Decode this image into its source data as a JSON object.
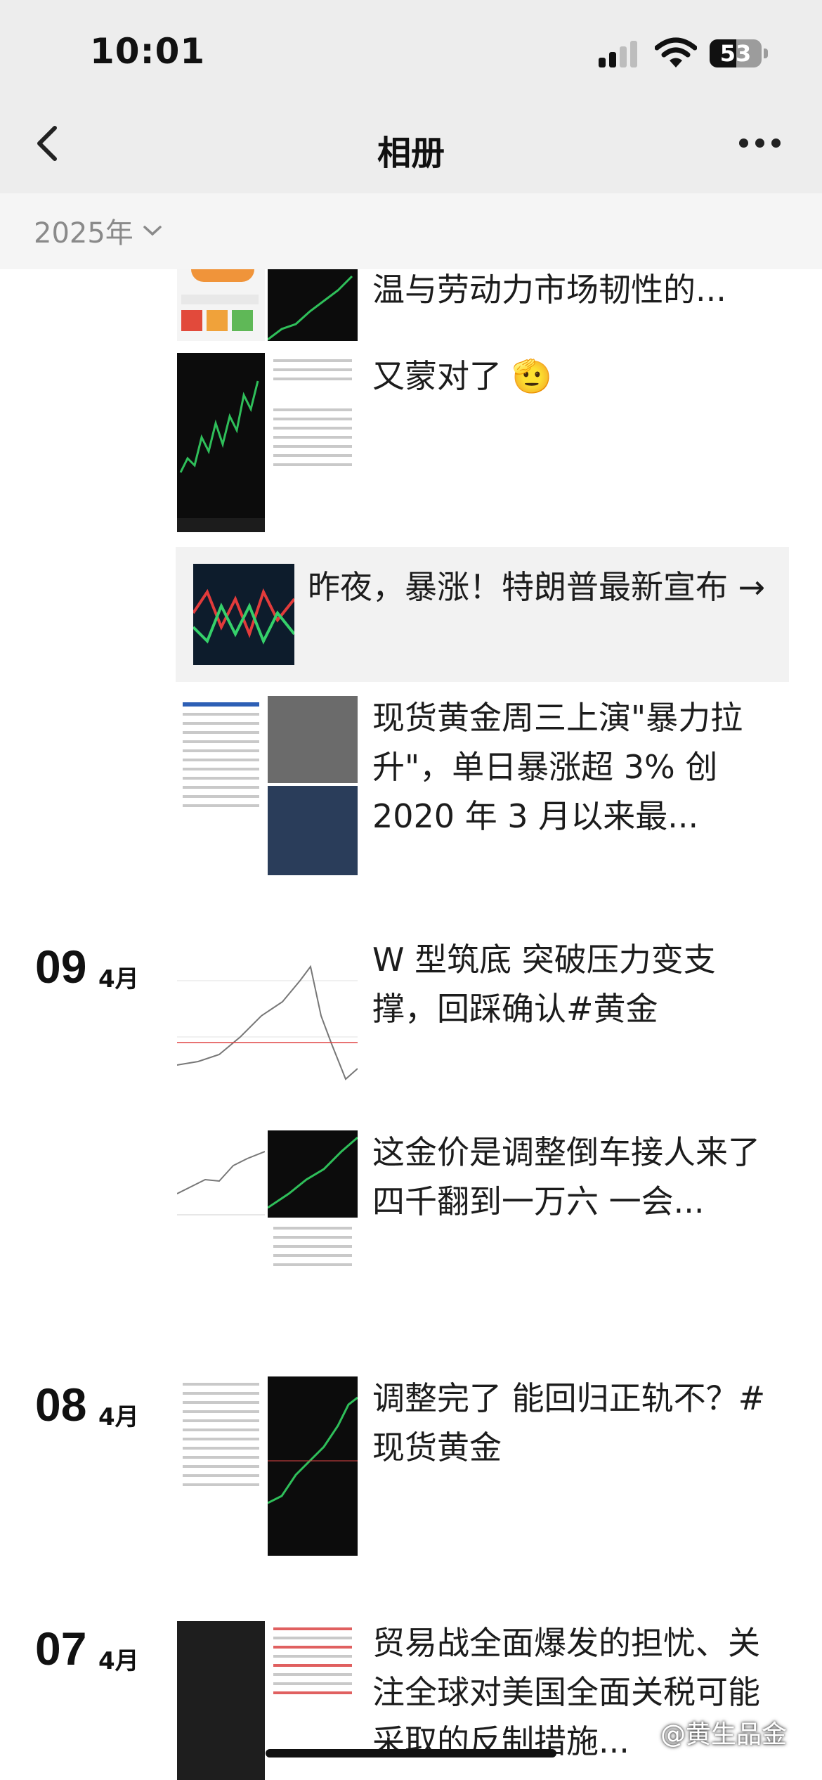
{
  "status": {
    "time": "10:01",
    "battery": "53"
  },
  "nav": {
    "title": "相册"
  },
  "year_filter": {
    "label": "2025年"
  },
  "feed": {
    "top_items": [
      {
        "text": "温与劳动力市场韧性的..."
      },
      {
        "text": "又蒙对了 🫡"
      }
    ],
    "link_card": {
      "title": "昨夜，暴涨！特朗普最新宣布 →"
    },
    "item3": {
      "text": "现货黄金周三上演\"暴力拉升\"，单日暴涨超 3% 创 2020 年 3 月以来最..."
    },
    "day09": {
      "day": "09",
      "month": "4月",
      "posts": [
        {
          "text": "W 型筑底  突破压力变支撑，回踩确认#黄金"
        },
        {
          "text": "这金价是调整倒车接人来了\n四千翻到一万六  一会..."
        }
      ]
    },
    "day08": {
      "day": "08",
      "month": "4月",
      "posts": [
        {
          "text": "调整完了  能回归正轨不？#现货黄金"
        }
      ]
    },
    "day07": {
      "day": "07",
      "month": "4月",
      "posts": [
        {
          "text": "贸易战全面爆发的担忧、关注全球对美国全面关税可能采取的反制措施..."
        }
      ]
    }
  },
  "watermark": "@黄生品金",
  "icons": [
    "back-chevron-icon",
    "more-dots-icon",
    "chevron-down-icon",
    "signal-icon",
    "wifi-icon",
    "battery-icon"
  ]
}
